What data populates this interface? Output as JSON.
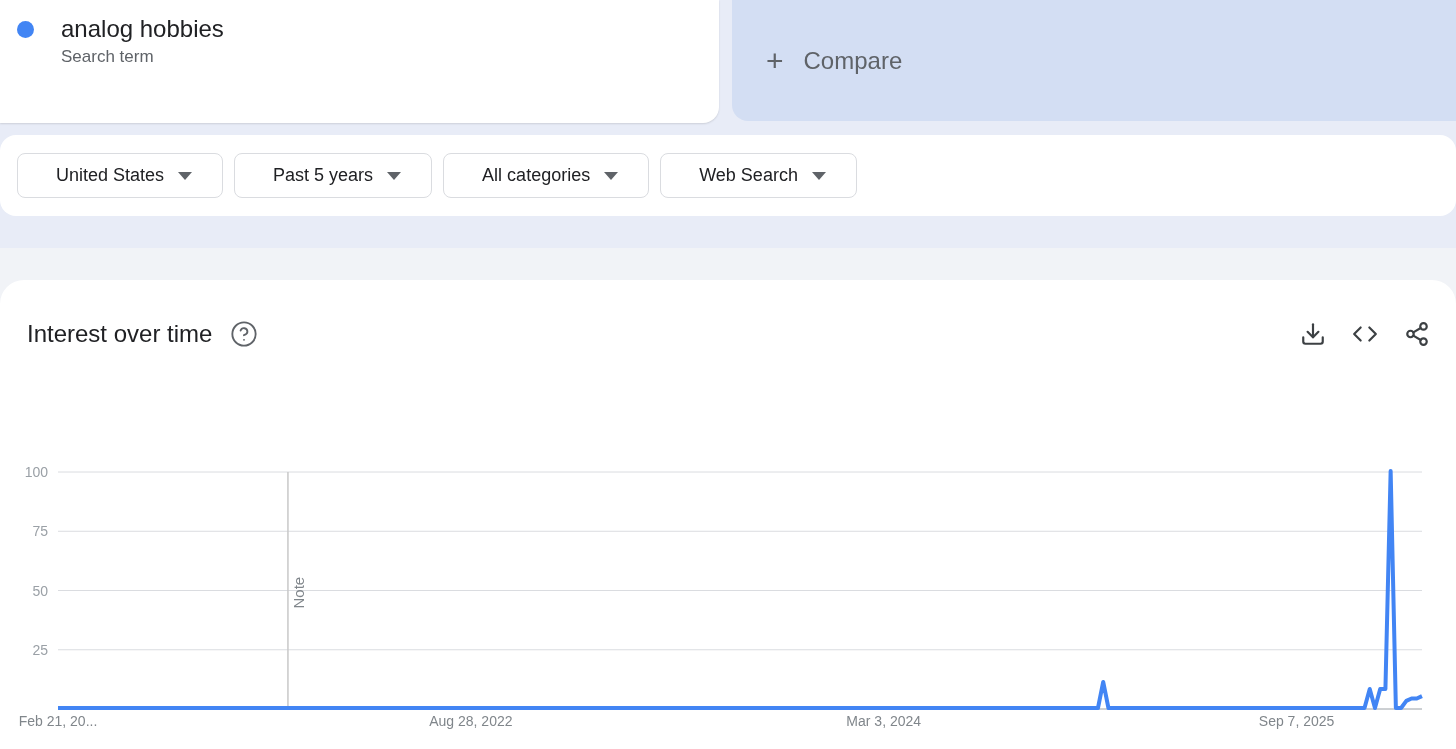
{
  "terms": [
    {
      "term": "analog hobbies",
      "label": "Search term",
      "color": "#4285f4"
    }
  ],
  "compare": {
    "icon": "+",
    "label": "Compare"
  },
  "filters": [
    {
      "label": "United States"
    },
    {
      "label": "Past 5 years"
    },
    {
      "label": "All categories"
    },
    {
      "label": "Web Search"
    }
  ],
  "interest_panel": {
    "title": "Interest over time",
    "chart_data": {
      "type": "line",
      "categories": [
        "Feb 21, 20...",
        null,
        null,
        null,
        null,
        null,
        null,
        null,
        null,
        null,
        null,
        null,
        null,
        null,
        null,
        null,
        null,
        null,
        null,
        null,
        null,
        null,
        null,
        null,
        null,
        null,
        null,
        null,
        null,
        null,
        null,
        null,
        null,
        null,
        null,
        null,
        null,
        null,
        null,
        null,
        null,
        null,
        null,
        null,
        null,
        null,
        null,
        null,
        null,
        null,
        null,
        null,
        null,
        null,
        null,
        null,
        null,
        null,
        null,
        null,
        null,
        null,
        null,
        null,
        null,
        null,
        null,
        null,
        null,
        null,
        null,
        null,
        null,
        null,
        null,
        null,
        null,
        null,
        null,
        "Aug 28, 2022",
        null,
        null,
        null,
        null,
        null,
        null,
        null,
        null,
        null,
        null,
        null,
        null,
        null,
        null,
        null,
        null,
        null,
        null,
        null,
        null,
        null,
        null,
        null,
        null,
        null,
        null,
        null,
        null,
        null,
        null,
        null,
        null,
        null,
        null,
        null,
        null,
        null,
        null,
        null,
        null,
        null,
        null,
        null,
        null,
        null,
        null,
        null,
        null,
        null,
        null,
        null,
        null,
        null,
        null,
        null,
        null,
        null,
        null,
        null,
        null,
        null,
        null,
        null,
        null,
        null,
        null,
        null,
        null,
        null,
        null,
        null,
        null,
        null,
        null,
        null,
        null,
        null,
        null,
        "Mar 3, 2024",
        null,
        null,
        null,
        null,
        null,
        null,
        null,
        null,
        null,
        null,
        null,
        null,
        null,
        null,
        null,
        null,
        null,
        null,
        null,
        null,
        null,
        null,
        null,
        null,
        null,
        null,
        null,
        null,
        null,
        null,
        null,
        null,
        null,
        null,
        null,
        null,
        null,
        null,
        null,
        null,
        null,
        null,
        null,
        null,
        null,
        null,
        null,
        null,
        null,
        null,
        null,
        null,
        null,
        null,
        null,
        null,
        null,
        null,
        null,
        null,
        null,
        null,
        null,
        null,
        null,
        null,
        null,
        null,
        null,
        null,
        null,
        null,
        null,
        null,
        null,
        null,
        null,
        null,
        "Sep 7, 2025",
        null,
        null,
        null,
        null,
        null,
        null,
        null,
        null,
        null,
        null,
        null,
        null,
        null,
        null,
        null,
        null,
        null,
        null,
        null,
        null,
        null,
        null,
        null,
        null
      ],
      "series": [
        {
          "color": "#4285f4",
          "values": [
            0,
            0,
            0,
            0,
            0,
            0,
            0,
            0,
            0,
            0,
            0,
            0,
            0,
            0,
            0,
            0,
            0,
            0,
            0,
            0,
            0,
            0,
            0,
            0,
            0,
            0,
            0,
            0,
            0,
            0,
            0,
            0,
            0,
            0,
            0,
            0,
            0,
            0,
            0,
            0,
            0,
            0,
            0,
            0,
            0,
            0,
            0,
            0,
            0,
            0,
            0,
            0,
            0,
            0,
            0,
            0,
            0,
            0,
            0,
            0,
            0,
            0,
            0,
            0,
            0,
            0,
            0,
            0,
            0,
            0,
            0,
            0,
            0,
            0,
            0,
            0,
            0,
            0,
            0,
            0,
            0,
            0,
            0,
            0,
            0,
            0,
            0,
            0,
            0,
            0,
            0,
            0,
            0,
            0,
            0,
            0,
            0,
            0,
            0,
            0,
            0,
            0,
            0,
            0,
            0,
            0,
            0,
            0,
            0,
            0,
            0,
            0,
            0,
            0,
            0,
            0,
            0,
            0,
            0,
            0,
            0,
            0,
            0,
            0,
            0,
            0,
            0,
            0,
            0,
            0,
            0,
            0,
            0,
            0,
            0,
            0,
            0,
            0,
            0,
            0,
            0,
            0,
            0,
            0,
            0,
            0,
            0,
            0,
            0,
            0,
            0,
            0,
            0,
            0,
            0,
            0,
            0,
            0,
            0,
            0,
            0,
            0,
            0,
            0,
            0,
            0,
            0,
            0,
            0,
            0,
            0,
            0,
            0,
            0,
            0,
            0,
            0,
            0,
            0,
            0,
            0,
            0,
            0,
            0,
            0,
            0,
            0,
            0,
            0,
            0,
            0,
            0,
            0,
            0,
            0,
            0,
            0,
            0,
            0,
            0,
            11,
            0,
            0,
            0,
            0,
            0,
            0,
            0,
            0,
            0,
            0,
            0,
            0,
            0,
            0,
            0,
            0,
            0,
            0,
            0,
            0,
            0,
            0,
            0,
            0,
            0,
            0,
            0,
            0,
            0,
            0,
            0,
            0,
            0,
            0,
            0,
            0,
            0,
            0,
            0,
            0,
            0,
            0,
            0,
            0,
            0,
            0,
            0,
            0,
            0,
            0,
            8,
            0,
            8,
            8,
            100,
            0,
            0,
            3,
            4,
            4,
            5
          ]
        }
      ],
      "ylim": [
        0,
        100
      ],
      "yticks": [
        25,
        50,
        75,
        100
      ],
      "grid": true,
      "annotations": [
        "Note"
      ]
    }
  }
}
